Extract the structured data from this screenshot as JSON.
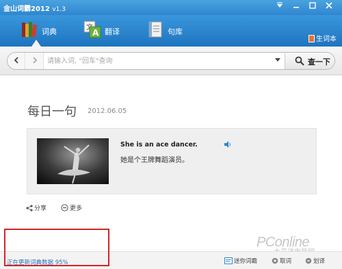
{
  "window": {
    "title": "金山词霸2012",
    "version": "v1.3",
    "controls": [
      "menu-down",
      "minimize",
      "maximize",
      "close"
    ]
  },
  "tabs": [
    {
      "label": "词典",
      "icon": "books-icon",
      "active": true
    },
    {
      "label": "翻译",
      "icon": "translate-icon",
      "active": false
    },
    {
      "label": "句库",
      "icon": "sentence-book-icon",
      "active": false
    }
  ],
  "wordbook": {
    "label": "生词本"
  },
  "search": {
    "placeholder": "请输入词, \"回车\"查询",
    "value": "",
    "button_label": "查一下"
  },
  "daily": {
    "title": "每日一句",
    "date": "2012.06.05",
    "sentence_en": "She is an ace dancer.",
    "sentence_cn": "她是个王牌舞蹈演员。",
    "actions": [
      {
        "label": "分享",
        "icon": "share-icon"
      },
      {
        "label": "更多",
        "icon": "more-icon"
      }
    ]
  },
  "statusbar": {
    "update_text": "正在更新词典数据 95%",
    "update_progress": 95,
    "items": [
      {
        "label": "迷你词霸",
        "icon": "mini-icon"
      },
      {
        "label": "取词",
        "icon": "pick-word-icon"
      },
      {
        "label": "划译",
        "icon": "select-translate-icon"
      }
    ]
  },
  "watermark": {
    "text": "PConline",
    "sub": "太平洋电脑网"
  },
  "colors": {
    "titlebar": "#2f86cf",
    "tabbar": "#1e74bf",
    "status_text": "#2a70b8",
    "highlight": "#d42424"
  }
}
